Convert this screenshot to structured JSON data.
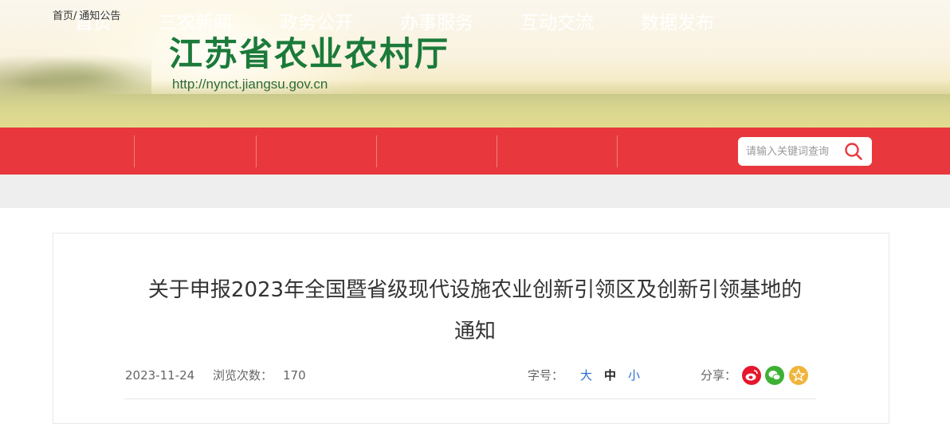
{
  "header": {
    "site_title": "江苏省农业农村厅",
    "site_url": "http://nynct.jiangsu.gov.cn"
  },
  "nav": {
    "items": [
      {
        "label": "首页"
      },
      {
        "label": "三农新闻"
      },
      {
        "label": "政务公开"
      },
      {
        "label": "办事服务"
      },
      {
        "label": "互动交流"
      },
      {
        "label": "数据发布"
      }
    ],
    "bg_color": "#e8383d"
  },
  "search": {
    "placeholder": "请输入关键词查询",
    "icon": "search-icon"
  },
  "breadcrumb": {
    "home": "首页",
    "separator": "/",
    "current": "通知公告"
  },
  "article": {
    "title_line1": "关于申报2023年全国暨省级现代设施农业创新引领区及创新引领基地的",
    "title_line2": "通知",
    "date": "2023-11-24",
    "views_label": "浏览次数：",
    "views_count": "170",
    "font_size_label": "字号：",
    "font_sizes": [
      "大",
      "中",
      "小"
    ],
    "share_label": "分享："
  },
  "share_icons": [
    {
      "name": "weibo-icon",
      "color": "#e6162d"
    },
    {
      "name": "wechat-icon",
      "color": "#3eb135"
    },
    {
      "name": "favorite-icon",
      "color": "#f0b43c"
    }
  ]
}
